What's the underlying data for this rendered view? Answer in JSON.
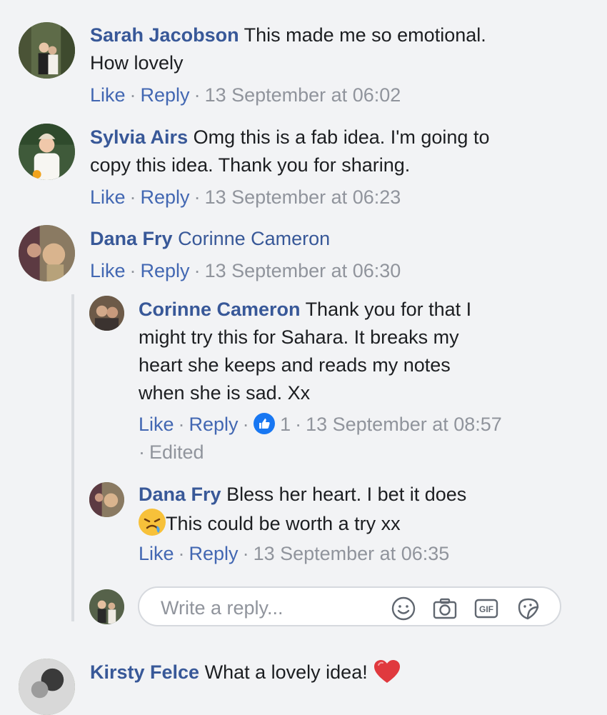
{
  "comments": [
    {
      "author": "Sarah Jacobson",
      "text": "This made me so emotional.",
      "text2": "How lovely",
      "like": "Like",
      "reply": "Reply",
      "time": "13 September at 06:02"
    },
    {
      "author": "Sylvia Airs",
      "text": "Omg this is a fab idea. I'm going to",
      "text2": "copy this idea. Thank you for sharing.",
      "like": "Like",
      "reply": "Reply",
      "time": "13 September at 06:23"
    },
    {
      "author": "Dana Fry",
      "mention": "Corinne Cameron",
      "like": "Like",
      "reply": "Reply",
      "time": "13 September at 06:30"
    }
  ],
  "replies": [
    {
      "author": "Corinne Cameron",
      "text": "Thank you for that I",
      "text2": "might try this for Sahara. It breaks my",
      "text3": "heart she keeps and reads my notes",
      "text4": "when she is sad. Xx",
      "like": "Like",
      "reply": "Reply",
      "reaction_count": "1",
      "time": "13 September at 08:57",
      "edited": "Edited"
    },
    {
      "author": "Dana Fry",
      "text": "Bless her heart. I bet it does",
      "text2": "This could be worth a try xx",
      "like": "Like",
      "reply": "Reply",
      "time": "13 September at 06:35"
    }
  ],
  "reply_box": {
    "placeholder": "Write a reply...",
    "icons": [
      "emoji-icon",
      "camera-icon",
      "gif-icon",
      "sticker-icon"
    ]
  },
  "last_comment": {
    "author": "Kirsty Felce",
    "text": "What a lovely idea!"
  },
  "colors": {
    "link": "#4267b2",
    "name": "#385898",
    "meta": "#90949c",
    "background": "#f2f3f5",
    "like_badge": "#1877f2",
    "heart": "#e0393e"
  }
}
